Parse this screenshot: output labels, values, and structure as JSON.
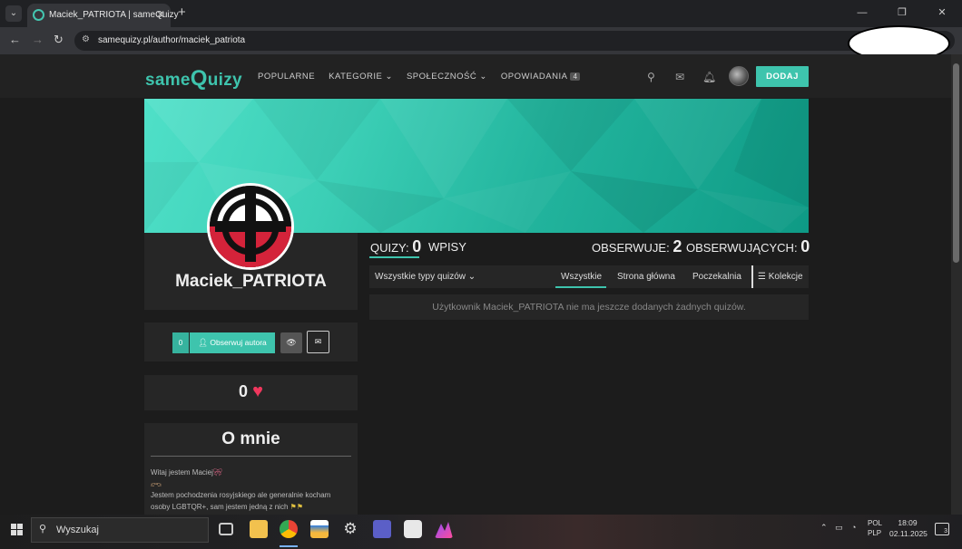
{
  "browser": {
    "tab_title": "Maciek_PATRIOTA | sameQuizy",
    "tab_close": "✕",
    "new_tab": "+",
    "url": "samequizy.pl/author/maciek_patriota",
    "window_buttons": [
      "—",
      "❐",
      "✕"
    ]
  },
  "site": {
    "logo_prefix": "same",
    "logo_q": "Q",
    "logo_suffix": "uizy",
    "nav": [
      {
        "label": "POPULARNE"
      },
      {
        "label": "KATEGORIE ⌄"
      },
      {
        "label": "SPOŁECZNOŚĆ ⌄"
      },
      {
        "label": "OPOWIADANIA",
        "badge": "4"
      }
    ],
    "add_button": "DODAJ"
  },
  "profile": {
    "username": "Maciek_PATRIOTA",
    "follow_count": "0",
    "follow_label": "Obserwuj autora",
    "likes": "0",
    "about_title": "O mnie",
    "about_lines": [
      "Witaj jestem Maciej",
      "",
      "Jestem pochodzenia rosyjskiego ale generalnie kocham",
      "osoby LGBTQR+, sam jestem jedną z nich"
    ]
  },
  "stats": {
    "quizy_label": "QUIZY:",
    "quizy_value": "0",
    "wpisy_label": "WPISY",
    "obserwuje_label": "OBSERWUJE:",
    "obserwuje_value": "2",
    "obserwujacych_label": "OBSERWUJĄCYCH:",
    "obserwujacych_value": "0"
  },
  "filters": {
    "type_select": "Wszystkie typy quizów ⌄",
    "tabs": [
      "Wszystkie",
      "Strona główna",
      "Poczekalnia"
    ],
    "active_tab": "Wszystkie",
    "collections": "Kolekcje"
  },
  "empty_message": "Użytkownik Maciek_PATRIOTA nie ma jeszcze dodanych żadnych quizów.",
  "taskbar": {
    "search": "Wyszukaj",
    "lang_top": "POL",
    "lang_bottom": "PLP",
    "time": "18:09",
    "date": "02.11.2025",
    "notifications": "3"
  },
  "colors": {
    "accent": "#3ec4ad",
    "heart": "#f0375d",
    "background": "#1c1c1c",
    "card": "#262626"
  }
}
